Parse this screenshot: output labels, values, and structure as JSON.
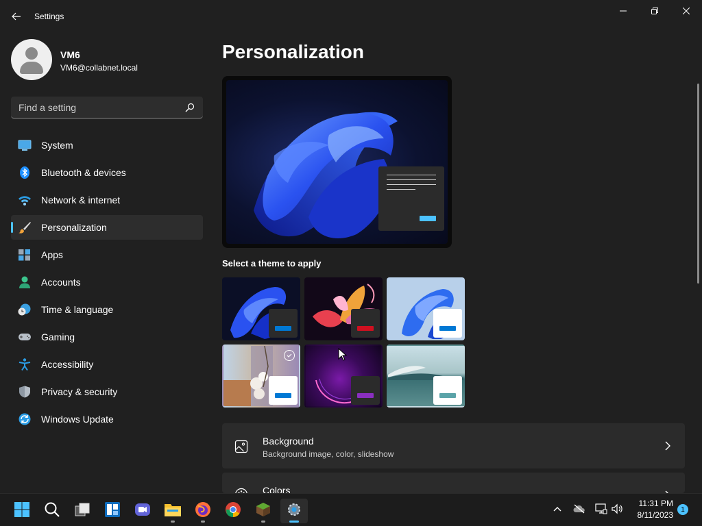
{
  "window": {
    "title": "Settings"
  },
  "user": {
    "name": "VM6",
    "email": "VM6@collabnet.local"
  },
  "search": {
    "placeholder": "Find a setting"
  },
  "sidebar": {
    "items": [
      {
        "label": "System",
        "icon": "system-icon",
        "active": false
      },
      {
        "label": "Bluetooth & devices",
        "icon": "bluetooth-icon",
        "active": false
      },
      {
        "label": "Network & internet",
        "icon": "wifi-icon",
        "active": false
      },
      {
        "label": "Personalization",
        "icon": "paintbrush-icon",
        "active": true
      },
      {
        "label": "Apps",
        "icon": "apps-icon",
        "active": false
      },
      {
        "label": "Accounts",
        "icon": "person-icon",
        "active": false
      },
      {
        "label": "Time & language",
        "icon": "globe-clock-icon",
        "active": false
      },
      {
        "label": "Gaming",
        "icon": "gamepad-icon",
        "active": false
      },
      {
        "label": "Accessibility",
        "icon": "accessibility-icon",
        "active": false
      },
      {
        "label": "Privacy & security",
        "icon": "shield-icon",
        "active": false
      },
      {
        "label": "Windows Update",
        "icon": "update-icon",
        "active": false
      }
    ]
  },
  "main": {
    "title": "Personalization",
    "theme_heading": "Select a theme to apply",
    "themes": [
      {
        "name": "windows-dark-bloom",
        "selected": false
      },
      {
        "name": "glow",
        "selected": false
      },
      {
        "name": "windows-light-bloom",
        "selected": false
      },
      {
        "name": "captured-motion",
        "selected": true
      },
      {
        "name": "flow",
        "selected": false
      },
      {
        "name": "sunrise",
        "selected": false
      }
    ],
    "cards": [
      {
        "title": "Background",
        "subtitle": "Background image, color, slideshow",
        "icon": "image-icon"
      },
      {
        "title": "Colors",
        "subtitle": "",
        "icon": "palette-icon"
      }
    ]
  },
  "taskbar": {
    "apps": [
      "start-icon",
      "search-icon",
      "task-view-icon",
      "widgets-icon",
      "teams-chat-icon",
      "file-explorer-icon",
      "firefox-icon",
      "chrome-icon",
      "minecraft-icon",
      "settings-icon"
    ],
    "clock_time": "11:31 PM",
    "clock_date": "8/11/2023",
    "notification_count": "1"
  },
  "colors": {
    "accent": "#4cc2ff",
    "background": "#202020",
    "card": "#2b2b2b"
  }
}
